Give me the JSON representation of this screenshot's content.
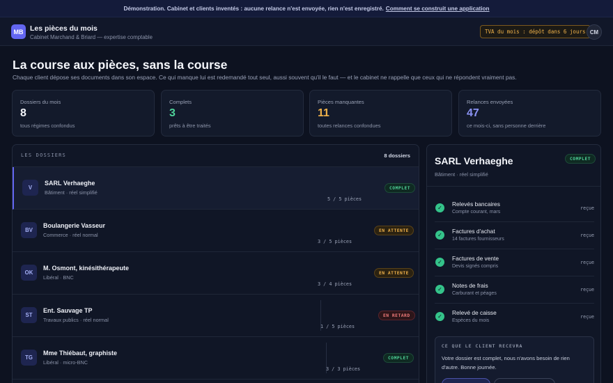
{
  "banner": {
    "text": "Démonstration. Cabinet et clients inventés : aucune relance n'est envoyée, rien n'est enregistré.",
    "link": "Comment se construit une application"
  },
  "header": {
    "logo": "MB",
    "title": "Les pièces du mois",
    "subtitle": "Cabinet Marchand & Briard — expertise comptable",
    "tva": "TVA du mois : dépôt dans 6 jours",
    "avatar": "CM"
  },
  "hero": {
    "title": "La course aux pièces, sans la course",
    "subtitle": "Chaque client dépose ses documents dans son espace. Ce qui manque lui est redemandé tout seul, aussi souvent qu'il le faut — et le cabinet ne rappelle que ceux qui ne répondent vraiment pas."
  },
  "stats": [
    {
      "label": "Dossiers du mois",
      "value": "8",
      "caption": "tous régimes confondus",
      "color": "#f4f6fb"
    },
    {
      "label": "Complets",
      "value": "3",
      "caption": "prêts à être traités",
      "color": "#4fd39a"
    },
    {
      "label": "Pièces manquantes",
      "value": "11",
      "caption": "toutes relances confondues",
      "color": "#f0b24a"
    },
    {
      "label": "Relances envoyées",
      "value": "47",
      "caption": "ce mois-ci, sans personne derrière",
      "color": "#8b93f5"
    }
  ],
  "list": {
    "title": "LES DOSSIERS",
    "count": "8 dossiers",
    "rows": [
      {
        "initials": "V",
        "name": "SARL Verhaeghe",
        "desc": "Bâtiment · réel simplifié",
        "progress": "5 / 5 pièces",
        "status": "COMPLET",
        "kind": "ok"
      },
      {
        "initials": "BV",
        "name": "Boulangerie Vasseur",
        "desc": "Commerce · réel normal",
        "progress": "3 / 5 pièces",
        "status": "EN ATTENTE",
        "kind": "wait"
      },
      {
        "initials": "OK",
        "name": "M. Osmont, kinésithérapeute",
        "desc": "Libéral · BNC",
        "progress": "3 / 4 pièces",
        "status": "EN ATTENTE",
        "kind": "wait"
      },
      {
        "initials": "ST",
        "name": "Ent. Sauvage TP",
        "desc": "Travaux publics · réel normal",
        "progress": "1 / 5 pièces",
        "status": "EN RETARD",
        "kind": "late"
      },
      {
        "initials": "TG",
        "name": "Mme Thiébaut, graphiste",
        "desc": "Libéral · micro-BNC",
        "progress": "3 / 3 pièces",
        "status": "COMPLET",
        "kind": "ok"
      }
    ]
  },
  "panel": {
    "title": "SARL Verhaeghe",
    "subtitle": "Bâtiment · réel simplifié",
    "badge": "COMPLET",
    "docs": [
      {
        "name": "Relevés bancaires",
        "desc": "Compte courant, mars",
        "status": "reçue"
      },
      {
        "name": "Factures d'achat",
        "desc": "14 factures fournisseurs",
        "status": "reçue"
      },
      {
        "name": "Factures de vente",
        "desc": "Devis signés compris",
        "status": "reçue"
      },
      {
        "name": "Notes de frais",
        "desc": "Carburant et péages",
        "status": "reçue"
      },
      {
        "name": "Relevé de caisse",
        "desc": "Espèces du mois",
        "status": "reçue"
      }
    ],
    "client_box": {
      "title": "CE QUE LE CLIENT RECEVRA",
      "body": "Votre dossier est complet, nous n'avons besoin de rien d'autre. Bonne journée."
    }
  }
}
